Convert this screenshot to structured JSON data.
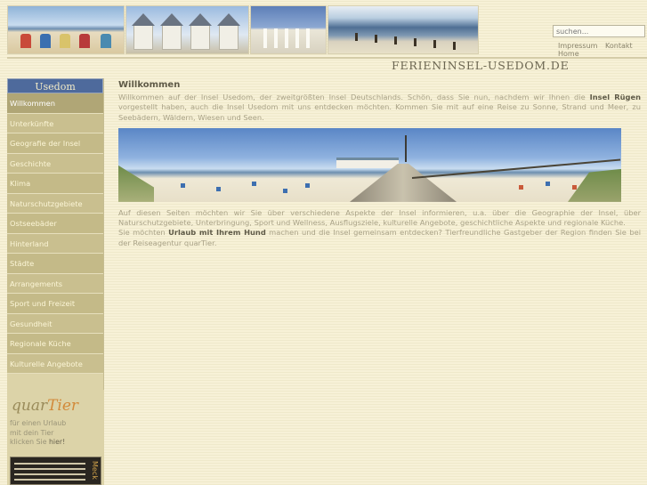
{
  "header": {
    "site_logo": "FERIENINSEL-USEDOM.DE",
    "search_placeholder": "suchen...",
    "top_links": [
      "Impressum",
      "Kontakt",
      "Home"
    ]
  },
  "sidebar": {
    "title": "Usedom",
    "items": [
      {
        "label": "Willkommen",
        "active": true
      },
      {
        "label": "Unterkünfte"
      },
      {
        "label": "Geografie der Insel"
      },
      {
        "label": "Geschichte"
      },
      {
        "label": "Klima"
      },
      {
        "label": "Naturschutzgebiete"
      },
      {
        "label": "Ostseebäder"
      },
      {
        "label": "Hinterland"
      },
      {
        "label": "Städte"
      },
      {
        "label": "Arrangements"
      },
      {
        "label": "Sport und Freizeit"
      },
      {
        "label": "Gesundheit"
      },
      {
        "label": "Regionale Küche"
      },
      {
        "label": "Kulturelle Angebote"
      }
    ],
    "ad": {
      "logo_part1": "quar",
      "logo_part2": "Tier",
      "line1": "für einen Urlaub",
      "line2": "mit dein Tier",
      "line3_prefix": "klicken Sie ",
      "line3_link": "hier!",
      "banner_text": "Meck"
    }
  },
  "main": {
    "heading": "Willkommen",
    "para1_before": "Willkommen auf der Insel Usedom, der zweitgrößten Insel Deutschlands. Schön, dass Sie nun, nachdem wir Ihnen die ",
    "para1_bold": "Insel Rügen",
    "para1_after": " vorgestellt haben, auch die Insel Usedom mit uns entdecken möchten. Kommen Sie mit auf eine Reise zu Sonne, Strand und Meer, zu Seebädern, Wäldern, Wiesen und Seen.",
    "para2": "Auf diesen Seiten möchten wir Sie über verschiedene Aspekte der Insel informieren, u.a. über die Geographie der Insel, über Naturschutzgebiete, Unterbringung, Sport und Wellness, Ausflugsziele, kulturelle Angebote, geschichtliche Aspekte und regionale Küche.",
    "para3_before": "Sie möchten ",
    "para3_bold": "Urlaub mit Ihrem Hund",
    "para3_after": " machen und die Insel gemeinsam entdecken? Tierfreundliche Gastgeber der Region finden Sie bei der Reiseagentur quarTier."
  },
  "colors": {
    "background": "#f7f1d7",
    "sidebar_bg": "#dcd3a8",
    "sidebar_title_bg": "#4e6a9c",
    "text": "#a9a287"
  }
}
